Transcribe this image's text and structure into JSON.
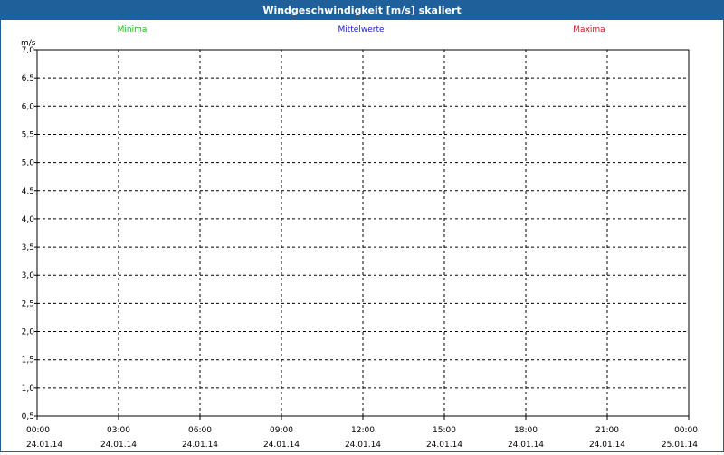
{
  "window": {
    "title": "Windgeschwindigkeit [m/s] skaliert"
  },
  "colors": {
    "title_bar": "#1f5f9a",
    "minima": "#22bb22",
    "mittelwerte": "#2222cc",
    "maxima": "#cc2222",
    "grid": "#000000"
  },
  "chart_data": {
    "type": "line",
    "title": "Windgeschwindigkeit [m/s] skaliert",
    "ylabel": "m/s",
    "xlabel": "",
    "ylim": [
      0.5,
      7.0
    ],
    "yticks": [
      "7,0",
      "6,5",
      "6,0",
      "5,5",
      "5,0",
      "4,5",
      "4,0",
      "3,5",
      "3,0",
      "2,5",
      "2,0",
      "1,5",
      "1,0",
      "0,5"
    ],
    "x_ticks": [
      {
        "time": "00:00",
        "date": "24.01.14"
      },
      {
        "time": "03:00",
        "date": "24.01.14"
      },
      {
        "time": "06:00",
        "date": "24.01.14"
      },
      {
        "time": "09:00",
        "date": "24.01.14"
      },
      {
        "time": "12:00",
        "date": "24.01.14"
      },
      {
        "time": "15:00",
        "date": "24.01.14"
      },
      {
        "time": "18:00",
        "date": "24.01.14"
      },
      {
        "time": "21:00",
        "date": "24.01.14"
      },
      {
        "time": "00:00",
        "date": "25.01.14"
      }
    ],
    "grid": true,
    "legend_position": "top",
    "series": [
      {
        "name": "Minima",
        "values": []
      },
      {
        "name": "Mittelwerte",
        "values": []
      },
      {
        "name": "Maxima",
        "values": []
      }
    ]
  }
}
